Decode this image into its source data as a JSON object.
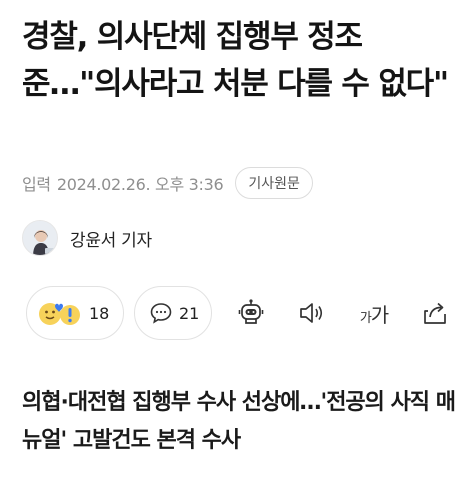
{
  "article": {
    "headline": "경찰, 의사단체 집행부 정조준…\"의사라고 처분 다를 수 없다\"",
    "meta": {
      "label": "입력",
      "datetime": "2024.02.26. 오후 3:36",
      "origin_button": "기사원문"
    },
    "reporter": {
      "name": "강윤서 기자"
    },
    "subheadline": "의협·대전협 집행부 수사 선상에…'전공의 사직 매뉴얼' 고발건도 본격 수사"
  },
  "actions": {
    "reactions": {
      "count": "18",
      "icon": "emoji-reaction-icon"
    },
    "comments": {
      "count": "21",
      "icon": "comment-icon"
    },
    "tts": {
      "icon": "robot-icon"
    },
    "audio": {
      "icon": "speaker-icon"
    },
    "font_size": {
      "label_small": "가",
      "label_large": "가"
    },
    "share": {
      "icon": "share-icon"
    }
  }
}
